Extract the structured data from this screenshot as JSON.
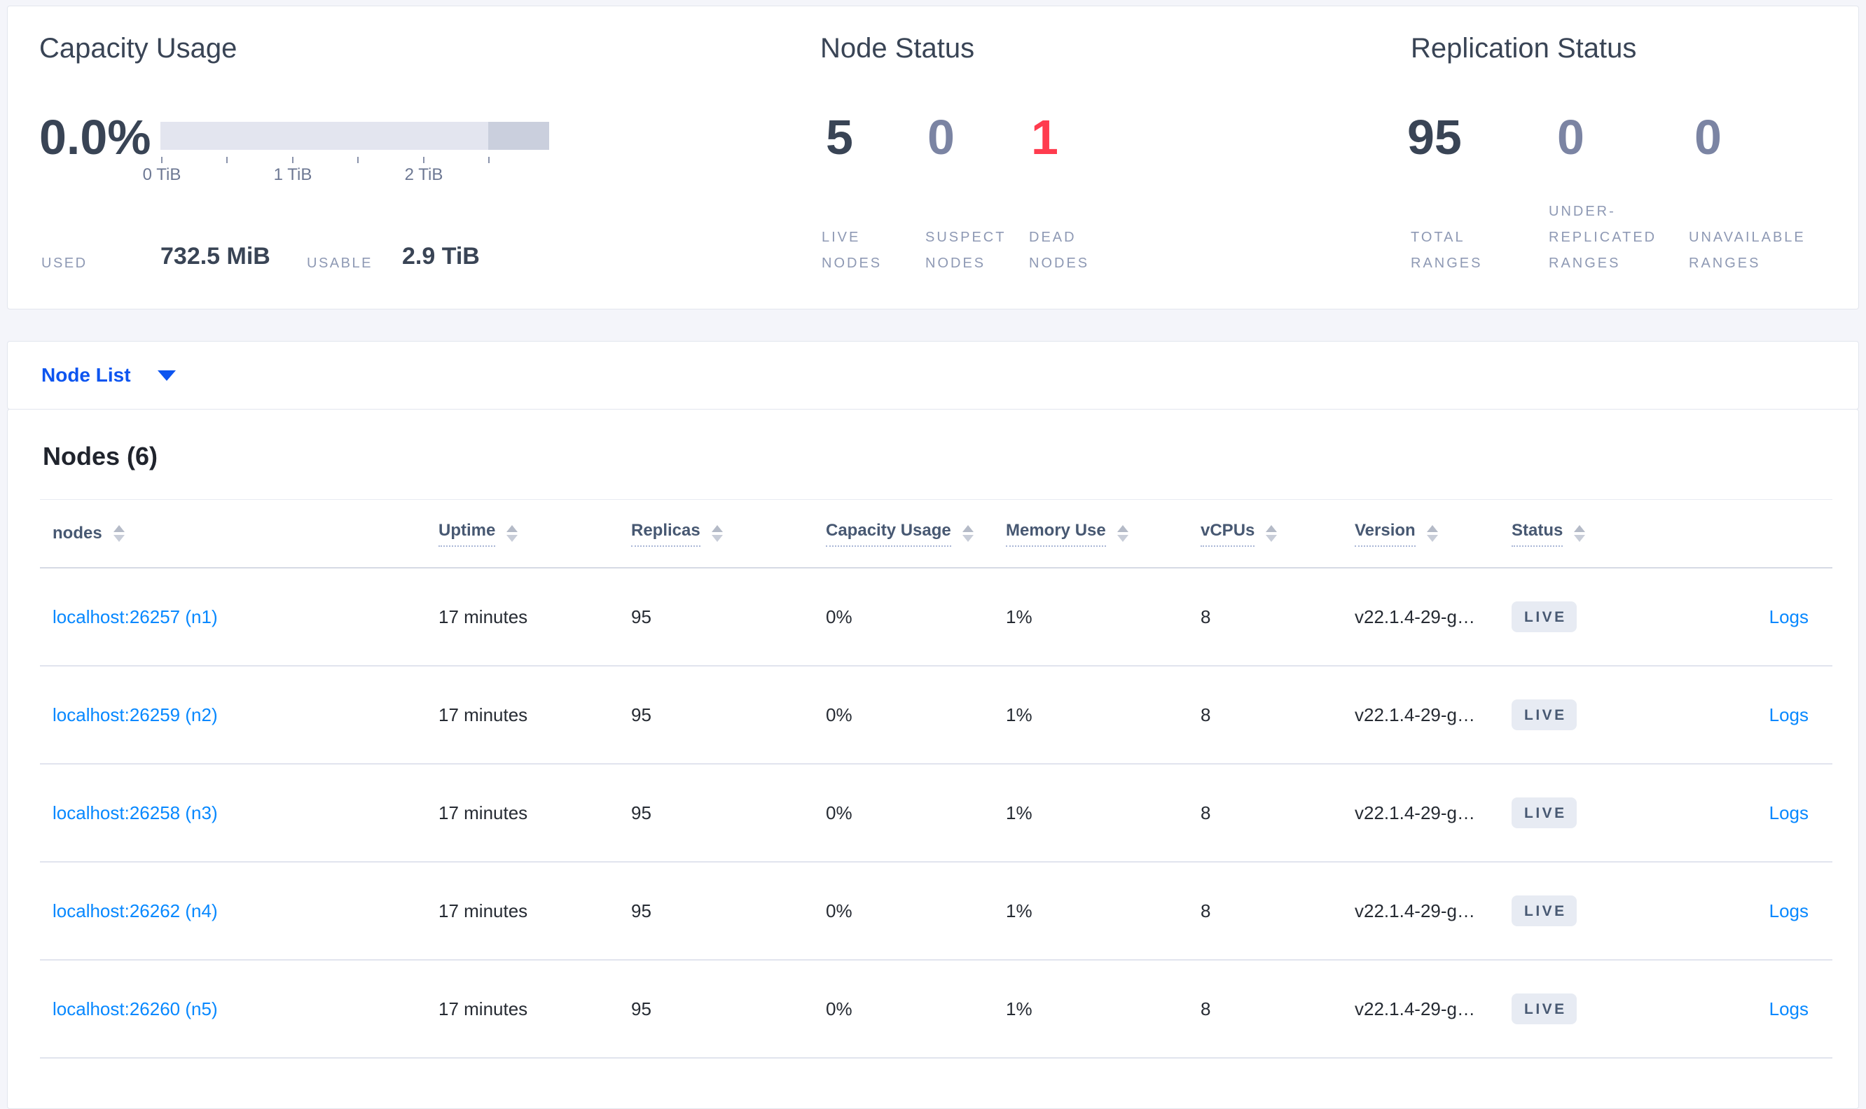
{
  "colors": {
    "page_bg": "#f4f5fa",
    "accent_blue": "#0d55f0",
    "link_blue": "#0788ff",
    "dead_red": "#ff3b4e",
    "dark_slate": "#394455",
    "muted_number": "#7b84a3",
    "bar_light": "#e3e5ef",
    "bar_dark": "#cacfdd",
    "badge_bg": "#e7ebf3"
  },
  "summary": {
    "capacity": {
      "title": "Capacity Usage",
      "percent": "0.0%",
      "used_label": "USED",
      "used_value": "732.5 MiB",
      "usable_label": "USABLE",
      "usable_value": "2.9 TiB",
      "tick_labels": [
        "0 TiB",
        "1 TiB",
        "2 TiB"
      ],
      "bar": {
        "total_tib": 2.96,
        "dark_segment_from_tib": 2.5,
        "used_fraction": 0.0
      }
    },
    "node_status": {
      "title": "Node Status",
      "stats": [
        {
          "value": "5",
          "label": "LIVE NODES"
        },
        {
          "value": "0",
          "label": "SUSPECT NODES"
        },
        {
          "value": "1",
          "label": "DEAD NODES"
        }
      ]
    },
    "replication_status": {
      "title": "Replication Status",
      "stats": [
        {
          "value": "95",
          "label": "TOTAL RANGES"
        },
        {
          "value": "0",
          "label": "UNDER-REPLICATED RANGES"
        },
        {
          "value": "0",
          "label": "UNAVAILABLE RANGES"
        }
      ]
    }
  },
  "node_list": {
    "dropdown_label": "Node List"
  },
  "nodes_table": {
    "title": "Nodes (6)",
    "columns": {
      "nodes": "nodes",
      "uptime": "Uptime",
      "replicas": "Replicas",
      "capacity": "Capacity Usage",
      "memory": "Memory Use",
      "vcpus": "vCPUs",
      "version": "Version",
      "status": "Status"
    },
    "rows": [
      {
        "node": "localhost:26257 (n1)",
        "uptime": "17 minutes",
        "replicas": "95",
        "capacity": "0%",
        "memory": "1%",
        "vcpus": "8",
        "version": "v22.1.4-29-g…",
        "status": "LIVE",
        "logs": "Logs"
      },
      {
        "node": "localhost:26259 (n2)",
        "uptime": "17 minutes",
        "replicas": "95",
        "capacity": "0%",
        "memory": "1%",
        "vcpus": "8",
        "version": "v22.1.4-29-g…",
        "status": "LIVE",
        "logs": "Logs"
      },
      {
        "node": "localhost:26258 (n3)",
        "uptime": "17 minutes",
        "replicas": "95",
        "capacity": "0%",
        "memory": "1%",
        "vcpus": "8",
        "version": "v22.1.4-29-g…",
        "status": "LIVE",
        "logs": "Logs"
      },
      {
        "node": "localhost:26262 (n4)",
        "uptime": "17 minutes",
        "replicas": "95",
        "capacity": "0%",
        "memory": "1%",
        "vcpus": "8",
        "version": "v22.1.4-29-g…",
        "status": "LIVE",
        "logs": "Logs"
      },
      {
        "node": "localhost:26260 (n5)",
        "uptime": "17 minutes",
        "replicas": "95",
        "capacity": "0%",
        "memory": "1%",
        "vcpus": "8",
        "version": "v22.1.4-29-g…",
        "status": "LIVE",
        "logs": "Logs"
      }
    ]
  }
}
